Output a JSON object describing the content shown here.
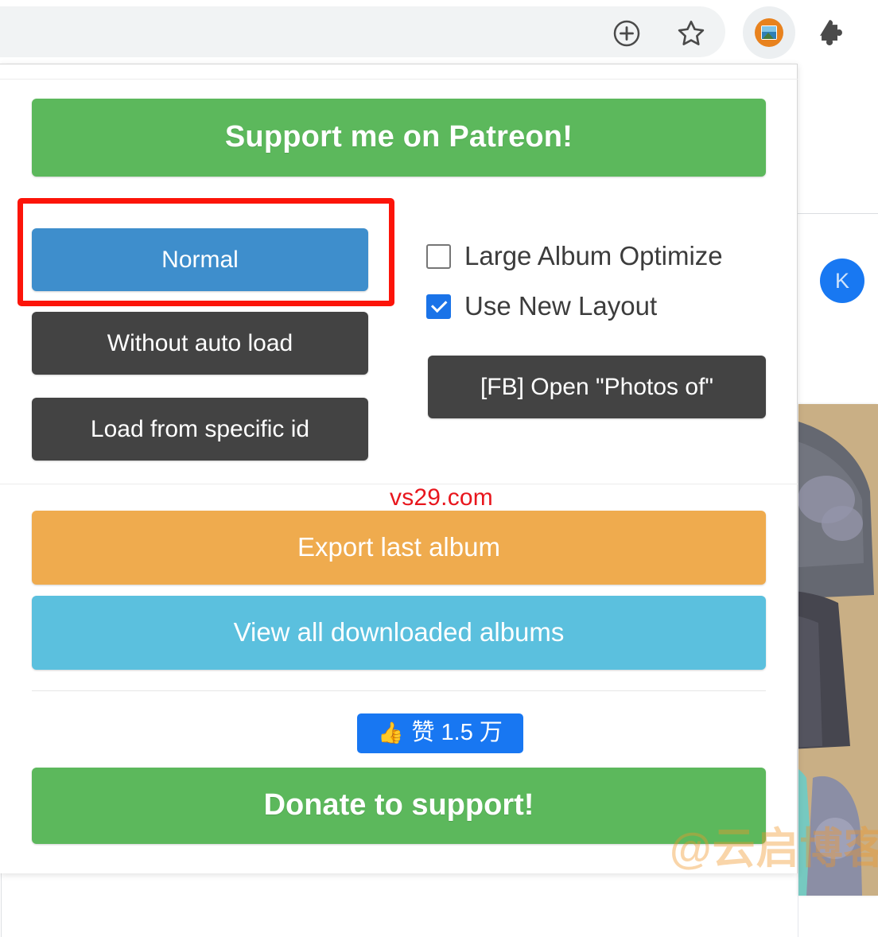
{
  "browser": {
    "icons": [
      {
        "name": "share-icon",
        "glyph": "⊕"
      },
      {
        "name": "bookmark-star-icon",
        "glyph": "☆"
      },
      {
        "name": "image-downloader-extension-icon",
        "glyph": ""
      },
      {
        "name": "extensions-puzzle-icon",
        "glyph": "🧩"
      }
    ]
  },
  "popup": {
    "patreon_button": "Support me on Patreon!",
    "mode_buttons": [
      {
        "label": "Normal",
        "state": "selected",
        "color": "#3e8ecc"
      },
      {
        "label": "Without auto load",
        "state": "default",
        "color": "#434343"
      },
      {
        "label": "Load from specific id",
        "state": "default",
        "color": "#434343"
      }
    ],
    "checkboxes": [
      {
        "label": "Large Album Optimize",
        "checked": false
      },
      {
        "label": "Use New Layout",
        "checked": true
      }
    ],
    "fb_button": "[FB] Open \"Photos of\"",
    "export_button": "Export last album",
    "view_all_button": "View all downloaded albums",
    "like_button": {
      "icon": "👍",
      "label": "赞 1.5 万"
    },
    "donate_button": "Donate to support!",
    "highlight": {
      "target": "Normal",
      "color": "#fc1409"
    }
  },
  "page": {
    "avatar_initial": "K"
  },
  "watermarks": {
    "site": "vs29.com",
    "blog": "@云启博客"
  },
  "colors": {
    "green": "#5cb85c",
    "blue": "#3e8ecc",
    "dark": "#434343",
    "orange": "#efab4e",
    "cyan": "#5bc0de",
    "facebook_blue": "#1877f2",
    "highlight_red": "#fc1409",
    "watermark_red": "#e8161d"
  }
}
